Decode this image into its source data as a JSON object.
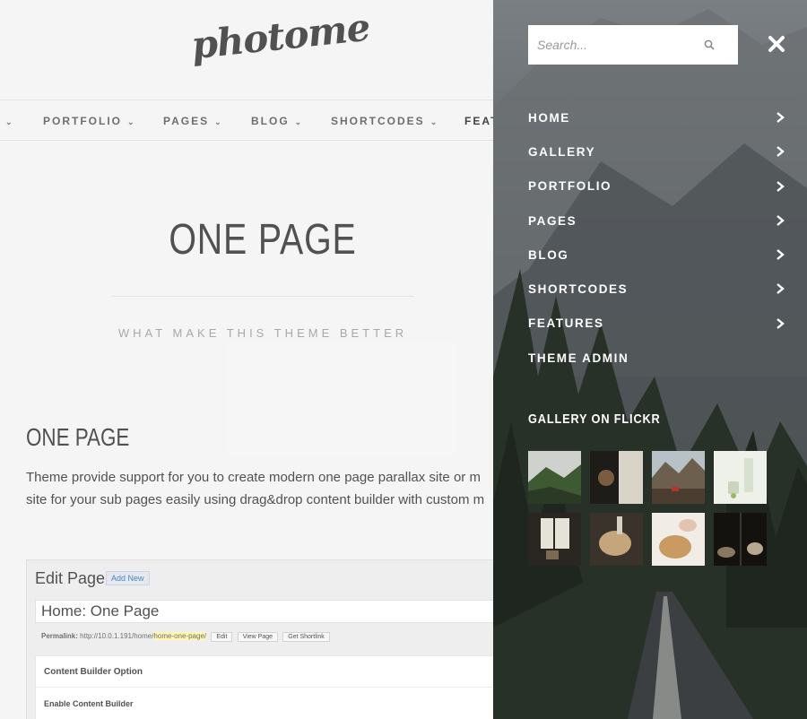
{
  "site": {
    "logo_text": "photome"
  },
  "top_nav": {
    "items": [
      {
        "label": "PORTFOLIO"
      },
      {
        "label": "PAGES"
      },
      {
        "label": "BLOG"
      },
      {
        "label": "SHORTCODES"
      },
      {
        "label": "FEAT"
      }
    ]
  },
  "hero": {
    "title": "ONE PAGE",
    "subtitle": "WHAT MAKE THIS THEME BETTER"
  },
  "content": {
    "heading": "ONE PAGE",
    "line1": "Theme provide support for you to create modern one page parallax site or m",
    "line2": "site for your sub pages easily using drag&drop content builder with custom m"
  },
  "edit_page": {
    "heading": "Edit Page",
    "add_new": "Add New",
    "title_value": "Home: One Page",
    "permalink_label": "Permalink:",
    "permalink_base": "http://10.0.1.191/home/",
    "permalink_slug": "home-one-page/",
    "buttons": [
      "Edit",
      "View Page",
      "Get Shortlink"
    ],
    "builder_option": "Content Builder Option",
    "enable_builder": "Enable Content Builder"
  },
  "side_panel": {
    "search": {
      "placeholder": "Search..."
    },
    "menu": [
      {
        "label": "HOME",
        "has_children": true
      },
      {
        "label": "GALLERY",
        "has_children": true
      },
      {
        "label": "PORTFOLIO",
        "has_children": true
      },
      {
        "label": "PAGES",
        "has_children": true
      },
      {
        "label": "BLOG",
        "has_children": true
      },
      {
        "label": "SHORTCODES",
        "has_children": true
      },
      {
        "label": "FEATURES",
        "has_children": true
      },
      {
        "label": "THEME ADMIN",
        "has_children": false
      }
    ],
    "flickr_title": "GALLERY ON FLICKR"
  },
  "colors": {
    "panel_text": "#ffffff",
    "page_bg": "#f4f4f4",
    "panel_bg": "#4a4f53"
  }
}
